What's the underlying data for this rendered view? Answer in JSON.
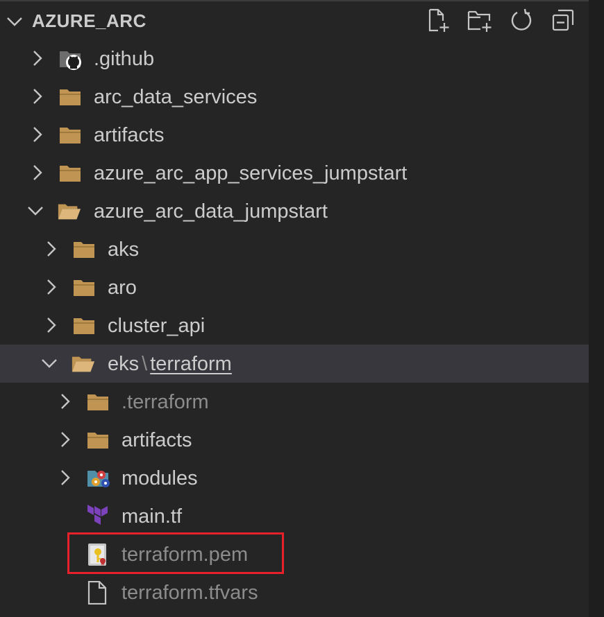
{
  "explorer": {
    "title": "AZURE_ARC",
    "actions": [
      {
        "name": "new-file",
        "icon": "new-file-icon"
      },
      {
        "name": "new-folder",
        "icon": "new-folder-icon"
      },
      {
        "name": "refresh",
        "icon": "refresh-icon"
      },
      {
        "name": "collapse-all",
        "icon": "collapse-all-icon"
      }
    ]
  },
  "tree": [
    {
      "label": ".github",
      "type": "folder",
      "expanded": false,
      "icon": "github-folder-icon"
    },
    {
      "label": "arc_data_services",
      "type": "folder",
      "expanded": false,
      "icon": "folder-icon"
    },
    {
      "label": "artifacts",
      "type": "folder",
      "expanded": false,
      "icon": "folder-icon"
    },
    {
      "label": "azure_arc_app_services_jumpstart",
      "type": "folder",
      "expanded": false,
      "icon": "folder-icon"
    },
    {
      "label": "azure_arc_data_jumpstart",
      "type": "folder",
      "expanded": true,
      "icon": "folder-open-icon"
    },
    {
      "label": "aks",
      "type": "folder",
      "expanded": false,
      "icon": "folder-icon"
    },
    {
      "label": "aro",
      "type": "folder",
      "expanded": false,
      "icon": "folder-icon"
    },
    {
      "label": "cluster_api",
      "type": "folder",
      "expanded": false,
      "icon": "folder-icon"
    },
    {
      "label_parts": [
        "eks",
        "\\",
        "terraform"
      ],
      "type": "folder",
      "expanded": true,
      "selected": true,
      "icon": "folder-open-icon"
    },
    {
      "label": ".terraform",
      "type": "folder",
      "expanded": false,
      "dim": true,
      "icon": "folder-icon"
    },
    {
      "label": "artifacts",
      "type": "folder",
      "expanded": false,
      "icon": "folder-icon"
    },
    {
      "label": "modules",
      "type": "folder",
      "expanded": false,
      "icon": "modules-folder-icon"
    },
    {
      "label": "main.tf",
      "type": "file",
      "icon": "terraform-icon"
    },
    {
      "label": "terraform.pem",
      "type": "file",
      "dim": true,
      "highlighted": true,
      "icon": "certificate-icon"
    },
    {
      "label": "terraform.tfvars",
      "type": "file",
      "dim": true,
      "icon": "file-icon"
    }
  ],
  "colors": {
    "background": "#252526",
    "selected_row": "#37373d",
    "text": "#cccccc",
    "dim_text": "#8c8c8c",
    "folder": "#c09553",
    "terraform": "#7b42bc",
    "highlight_box": "#e8202a"
  }
}
